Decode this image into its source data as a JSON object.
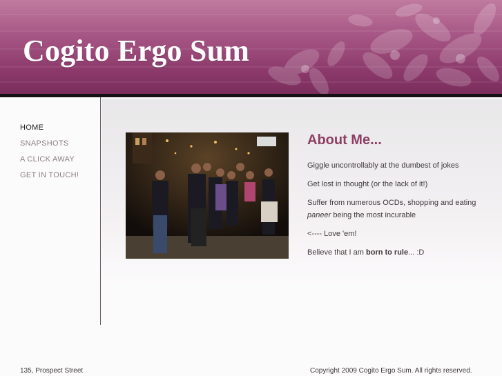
{
  "header": {
    "site_title": "Cogito Ergo Sum"
  },
  "nav": {
    "items": [
      {
        "label": "HOME",
        "active": true
      },
      {
        "label": "SNAPSHOTS",
        "active": false
      },
      {
        "label": "A CLICK AWAY",
        "active": false
      },
      {
        "label": "GET IN TOUCH!",
        "active": false
      }
    ]
  },
  "about": {
    "title": "About Me...",
    "line1": "Giggle uncontrollably at the dumbest of jokes",
    "line2": "Get lost in thought (or the lack of it!)",
    "line3_pre": "Suffer from numerous OCDs, shopping and eating ",
    "line3_em": "paneer",
    "line3_post": " being the most incurable",
    "line4": "<---- Love 'em!",
    "line5_pre": "Believe that I am ",
    "line5_bold": "born to rule",
    "line5_post": "... :D"
  },
  "photo": {
    "icon": "group-photo-icon"
  },
  "footer": {
    "address": "135, Prospect Street",
    "copyright": "Copyright 2009 Cogito Ergo Sum. All rights reserved."
  },
  "colors": {
    "header_light": "#c07b9f",
    "header_dark": "#7a2d5c",
    "accent": "#8d3e64",
    "header_bar": "#161014"
  }
}
